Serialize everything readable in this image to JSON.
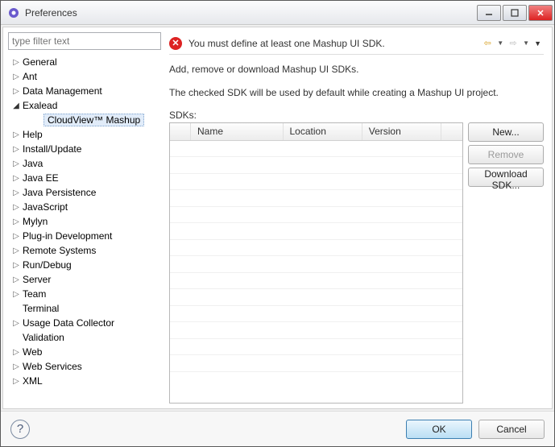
{
  "window": {
    "title": "Preferences"
  },
  "filter": {
    "placeholder": "type filter text"
  },
  "tree": [
    {
      "label": "General",
      "expandable": true,
      "expanded": false,
      "depth": 1
    },
    {
      "label": "Ant",
      "expandable": true,
      "expanded": false,
      "depth": 1
    },
    {
      "label": "Data Management",
      "expandable": true,
      "expanded": false,
      "depth": 1
    },
    {
      "label": "Exalead",
      "expandable": true,
      "expanded": true,
      "depth": 1
    },
    {
      "label": "CloudView™ Mashup",
      "expandable": false,
      "expanded": false,
      "depth": 2,
      "selected": true
    },
    {
      "label": "Help",
      "expandable": true,
      "expanded": false,
      "depth": 1
    },
    {
      "label": "Install/Update",
      "expandable": true,
      "expanded": false,
      "depth": 1
    },
    {
      "label": "Java",
      "expandable": true,
      "expanded": false,
      "depth": 1
    },
    {
      "label": "Java EE",
      "expandable": true,
      "expanded": false,
      "depth": 1
    },
    {
      "label": "Java Persistence",
      "expandable": true,
      "expanded": false,
      "depth": 1
    },
    {
      "label": "JavaScript",
      "expandable": true,
      "expanded": false,
      "depth": 1
    },
    {
      "label": "Mylyn",
      "expandable": true,
      "expanded": false,
      "depth": 1
    },
    {
      "label": "Plug-in Development",
      "expandable": true,
      "expanded": false,
      "depth": 1
    },
    {
      "label": "Remote Systems",
      "expandable": true,
      "expanded": false,
      "depth": 1
    },
    {
      "label": "Run/Debug",
      "expandable": true,
      "expanded": false,
      "depth": 1
    },
    {
      "label": "Server",
      "expandable": true,
      "expanded": false,
      "depth": 1
    },
    {
      "label": "Team",
      "expandable": true,
      "expanded": false,
      "depth": 1
    },
    {
      "label": "Terminal",
      "expandable": false,
      "expanded": false,
      "depth": 1
    },
    {
      "label": "Usage Data Collector",
      "expandable": true,
      "expanded": false,
      "depth": 1
    },
    {
      "label": "Validation",
      "expandable": false,
      "expanded": false,
      "depth": 1
    },
    {
      "label": "Web",
      "expandable": true,
      "expanded": false,
      "depth": 1
    },
    {
      "label": "Web Services",
      "expandable": true,
      "expanded": false,
      "depth": 1
    },
    {
      "label": "XML",
      "expandable": true,
      "expanded": false,
      "depth": 1
    }
  ],
  "message": {
    "text": "You must define at least one Mashup UI SDK."
  },
  "content": {
    "line1": "Add, remove or download Mashup UI SDKs.",
    "line2": "The checked SDK will be used by default while creating a Mashup UI project.",
    "sdks_label": "SDKs:",
    "columns": {
      "name": "Name",
      "location": "Location",
      "version": "Version"
    }
  },
  "buttons": {
    "new": "New...",
    "remove": "Remove",
    "download": "Download SDK...",
    "ok": "OK",
    "cancel": "Cancel"
  }
}
